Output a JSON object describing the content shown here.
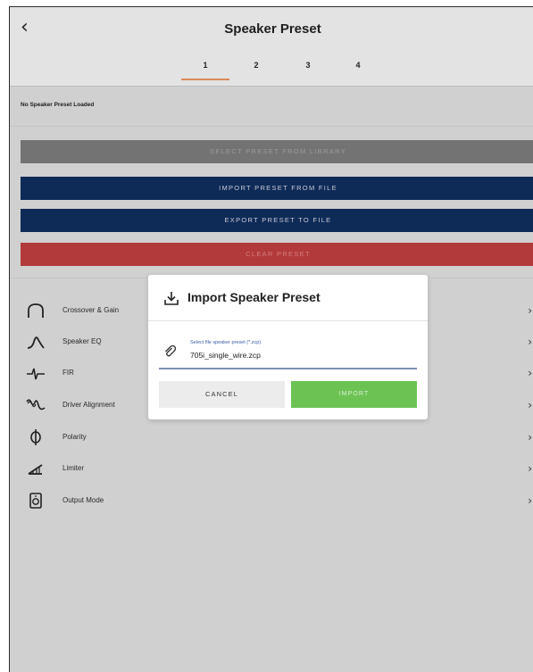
{
  "header": {
    "back_glyph": "‹",
    "title": "Speaker Preset",
    "tabs": [
      {
        "label": "1",
        "active": true
      },
      {
        "label": "2",
        "active": false
      },
      {
        "label": "3",
        "active": false
      },
      {
        "label": "4",
        "active": false
      }
    ]
  },
  "status_text": "No Speaker Preset Loaded",
  "actions": {
    "select_library": "SELECT PRESET FROM LIBRARY",
    "import_file": "IMPORT PRESET FROM FILE",
    "export_file": "EXPORT PRESET TO FILE",
    "clear": "CLEAR PRESET"
  },
  "settings_list": [
    {
      "label": "Crossover & Gain",
      "icon": "crossover-icon"
    },
    {
      "label": "Speaker EQ",
      "icon": "eq-curve-icon"
    },
    {
      "label": "FIR",
      "icon": "fir-icon"
    },
    {
      "label": "Driver Alignment",
      "icon": "driver-alignment-icon"
    },
    {
      "label": "Polarity",
      "icon": "polarity-icon"
    },
    {
      "label": "Limiter",
      "icon": "limiter-icon"
    },
    {
      "label": "Output Mode",
      "icon": "output-mode-icon"
    }
  ],
  "chevron_glyph": "›",
  "modal": {
    "title": "Import Speaker Preset",
    "title_icon": "download-icon",
    "field_label": "Select file speaker preset (*.zcp)",
    "field_value": "705i_single_wire.zcp",
    "field_icon": "paperclip-icon",
    "cancel_label": "CANCEL",
    "import_label": "IMPORT"
  },
  "colors": {
    "navy": "#0e2a57",
    "red": "#b33a3a",
    "green": "#6cc354",
    "gray_button": "#737373",
    "tab_underline": "#d98a5a",
    "link_blue": "#3a5ea8"
  }
}
